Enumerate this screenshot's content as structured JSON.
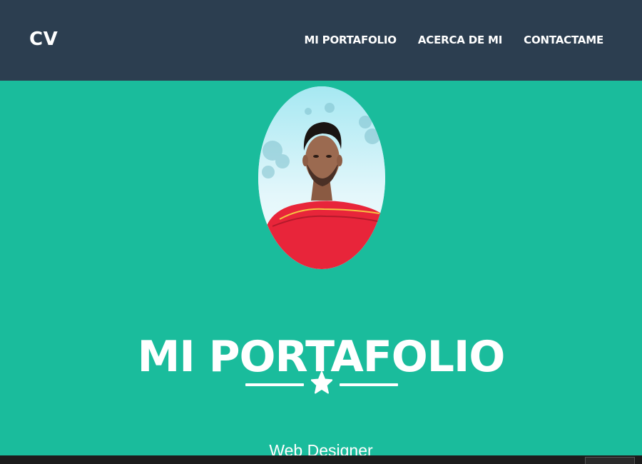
{
  "navbar": {
    "brand": "CV",
    "items": [
      {
        "label": "MI PORTAFOLIO"
      },
      {
        "label": "ACERCA DE MI"
      },
      {
        "label": "CONTACTAME"
      }
    ]
  },
  "hero": {
    "title": "MI PORTAFOLIO",
    "subtitle": "Web Designer",
    "divider_icon": "star-icon"
  },
  "colors": {
    "navbar": "#2c3e50",
    "hero": "#1abc9c",
    "text": "#ffffff",
    "shirt": "#e8253a"
  }
}
